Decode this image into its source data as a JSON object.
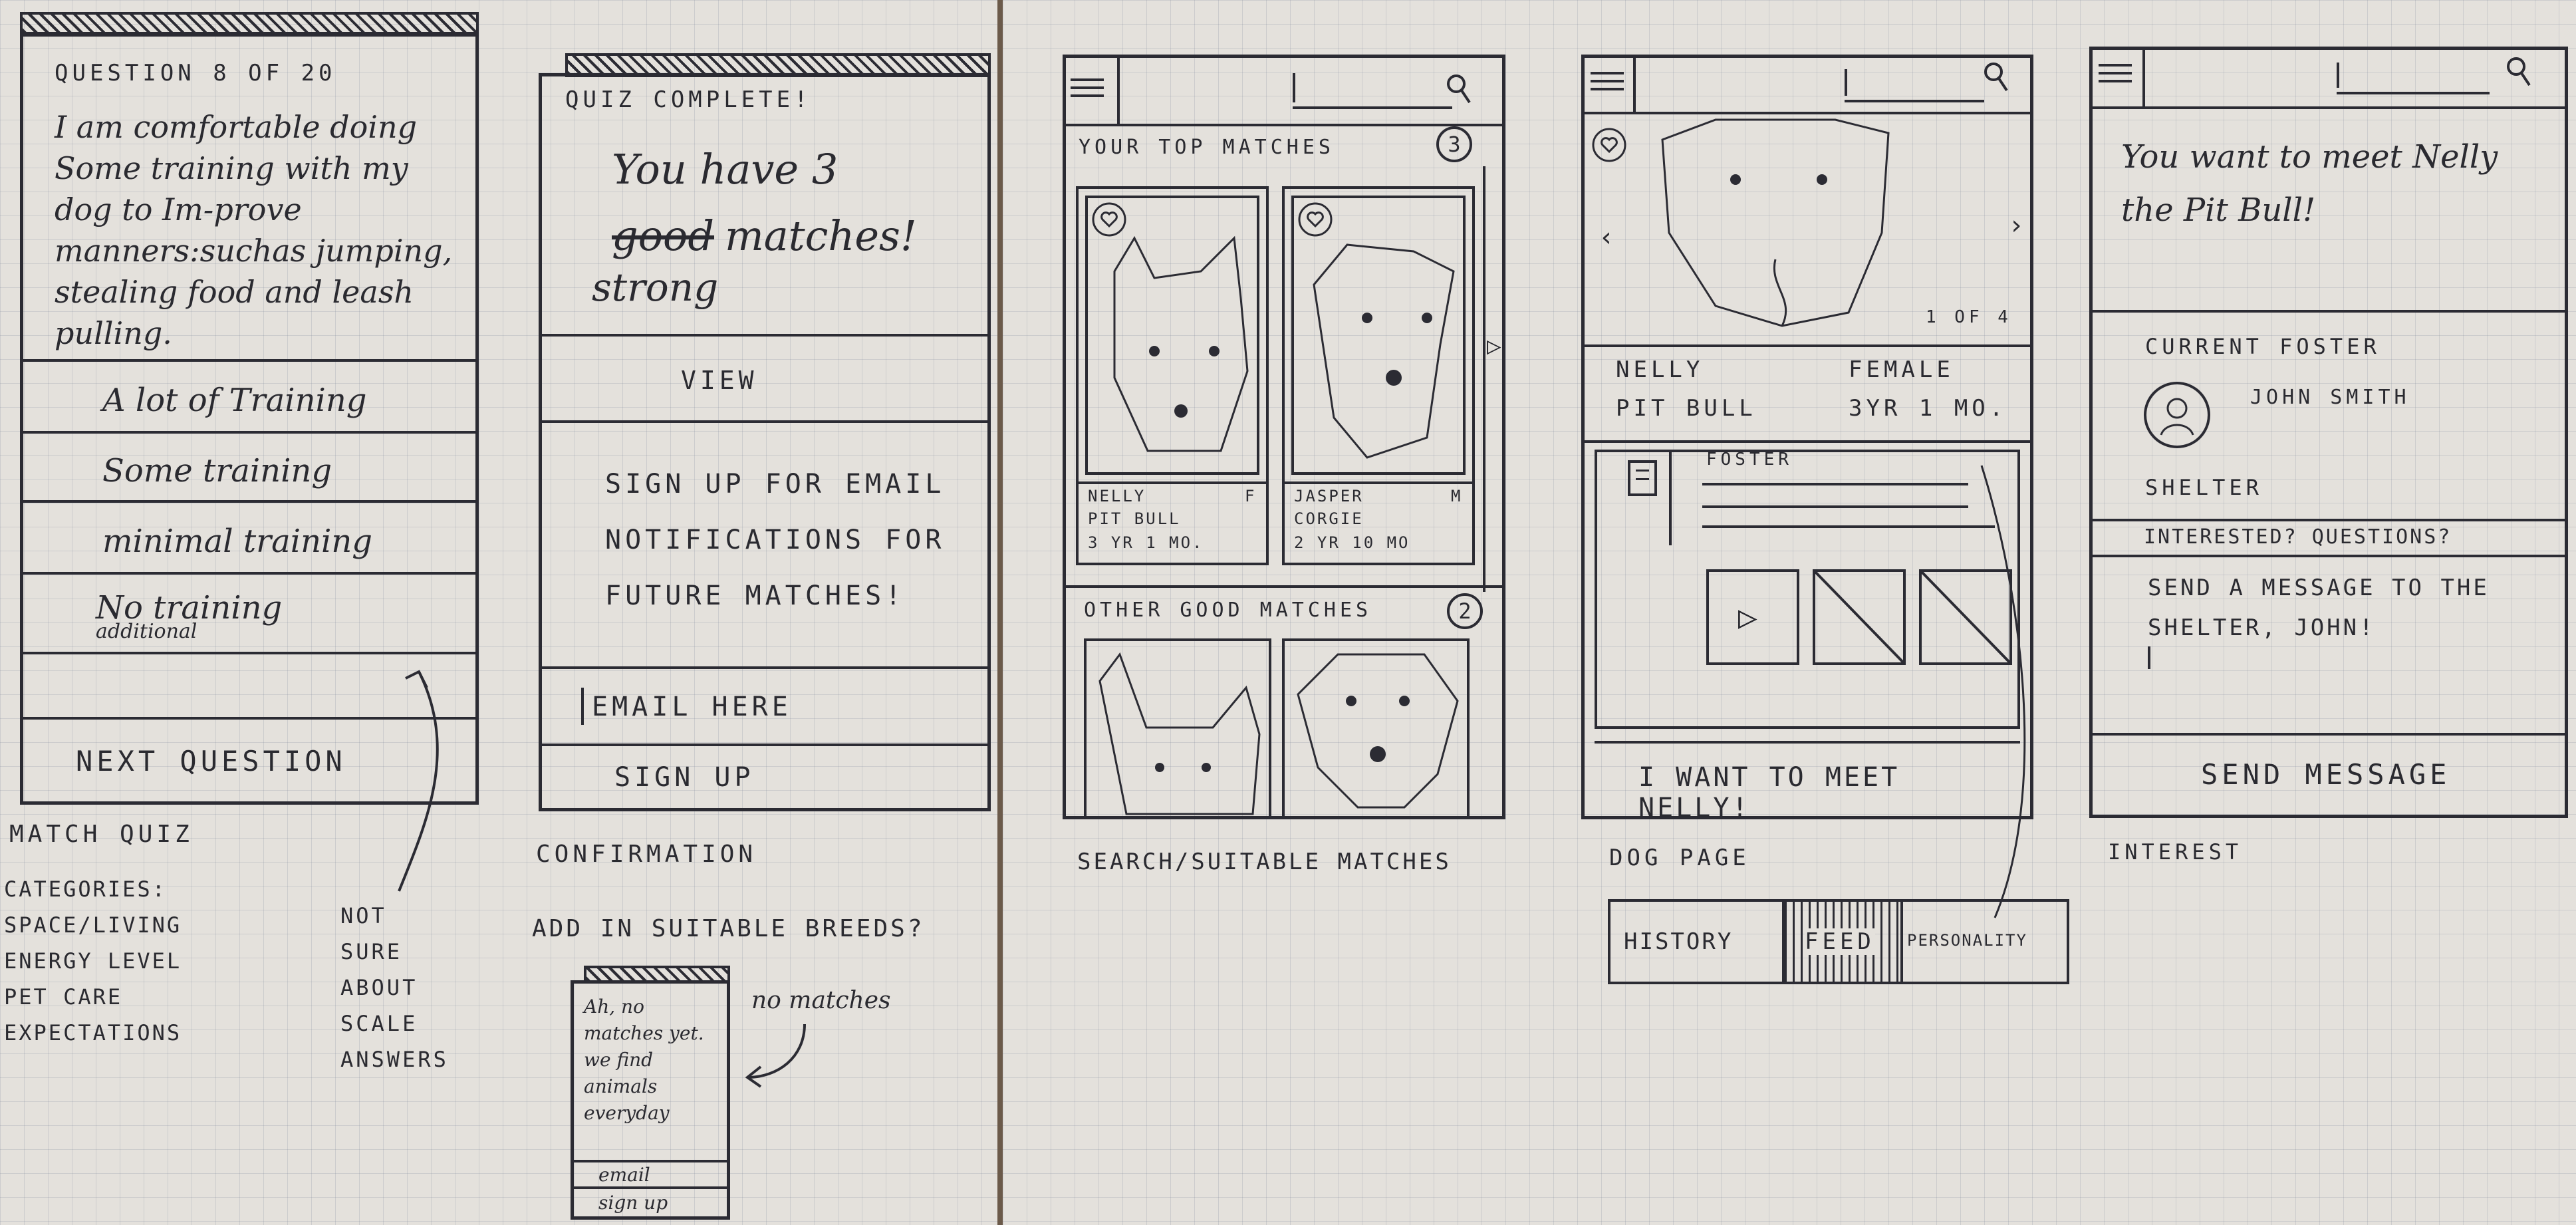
{
  "quiz": {
    "question_counter": "QUESTION 8 OF 20",
    "question_text": "I am comfortable doing Some training with my dog to Im-prove manners:suchas jumping, stealing food and leash pulling.",
    "options": [
      "A lot of Training",
      "Some training",
      "minimal training",
      "No training"
    ],
    "option_note": "additional",
    "next_label": "NEXT QUESTION",
    "screen_label": "MATCH QUIZ",
    "categories_note": "CATEGORIES:\nSPACE/LIVING\nENERGY LEVEL\nPET CARE\nEXPECTATIONS",
    "side_note": "NOT\nSURE\nABOUT\nSCALE\nANSWERS"
  },
  "confirmation": {
    "header": "QUIZ COMPLETE!",
    "result_line1": "You have 3",
    "struck_word": "good",
    "result_line2": "matches!",
    "replacement_word": "strong",
    "view_label": "VIEW",
    "signup_prompt": "SIGN UP FOR EMAIL NOTIFICATIONS FOR FUTURE MATCHES!",
    "email_placeholder": "EMAIL HERE",
    "signup_label": "SIGN UP",
    "screen_label": "CONFIRMATION",
    "breeds_note": "ADD IN SUITABLE BREEDS?"
  },
  "no_matches": {
    "message": "Ah, no matches yet. we find animals everyday",
    "email_label": "email",
    "signup_label": "sign up",
    "note": "no matches"
  },
  "search": {
    "top_title": "YOUR TOP MATCHES",
    "top_count": "3",
    "card1": {
      "name": "NELLY",
      "sex": "F",
      "breed": "PIT BULL",
      "age": "3 YR 1 MO."
    },
    "card2": {
      "name": "JASPER",
      "sex": "M",
      "breed": "CORGIE",
      "age": "2 YR 10 MO"
    },
    "other_title": "OTHER GOOD MATCHES",
    "other_count": "2",
    "screen_label": "SEARCH/SUITABLE MATCHES"
  },
  "dog_page": {
    "counter": "1 OF 4",
    "name": "NELLY",
    "sex": "FEMALE",
    "breed": "PIT BULL",
    "age": "3YR 1 MO.",
    "foster_label": "FOSTER",
    "cta_label": "I WANT TO MEET NELLY!",
    "screen_label": "DOG PAGE",
    "tabs": [
      "HISTORY",
      "FEED",
      "PERSONALITY"
    ]
  },
  "interest": {
    "headline": "You want to meet Nelly the Pit Bull!",
    "foster_label": "CURRENT FOSTER",
    "foster_name": "JOHN SMITH",
    "shelter_label": "SHELTER",
    "questions_label": "INTERESTED? QUESTIONS?",
    "message_text": "SEND A MESSAGE TO THE SHELTER, JOHN!",
    "send_label": "SEND MESSAGE",
    "screen_label": "INTEREST"
  }
}
